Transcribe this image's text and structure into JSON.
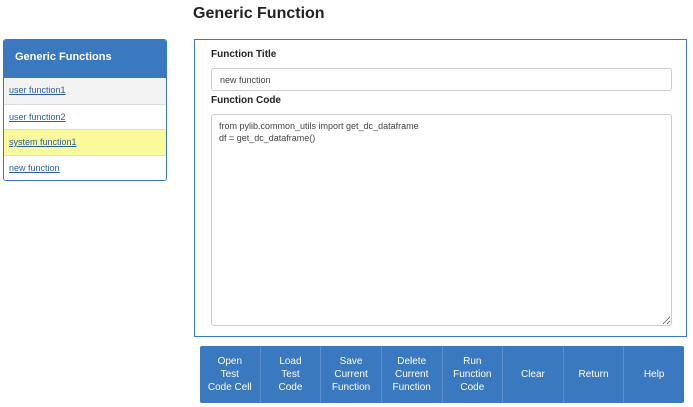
{
  "page": {
    "title": "Generic Function"
  },
  "sidebar": {
    "header": "Generic Functions",
    "items": [
      {
        "label": "user function1"
      },
      {
        "label": "user function2"
      },
      {
        "label": "system function1"
      },
      {
        "label": "new function"
      }
    ],
    "highlight_color": "#fafa9c"
  },
  "form": {
    "title_label": "Function Title",
    "title_value": "new function",
    "code_label": "Function Code",
    "code_value": "from pylib.common_utils import get_dc_dataframe\ndf = get_dc_dataframe()"
  },
  "buttons": {
    "open_test_code_cell": "Open\nTest\nCode Cell",
    "load_test_code": "Load\nTest\nCode",
    "save_current_function": "Save\nCurrent\nFunction",
    "delete_current_function": "Delete\nCurrent\nFunction",
    "run_function_code": "Run\nFunction\nCode",
    "clear": "Clear",
    "return": "Return",
    "help": "Help"
  },
  "colors": {
    "accent": "#3a78c0",
    "link": "#2a5f9e"
  }
}
